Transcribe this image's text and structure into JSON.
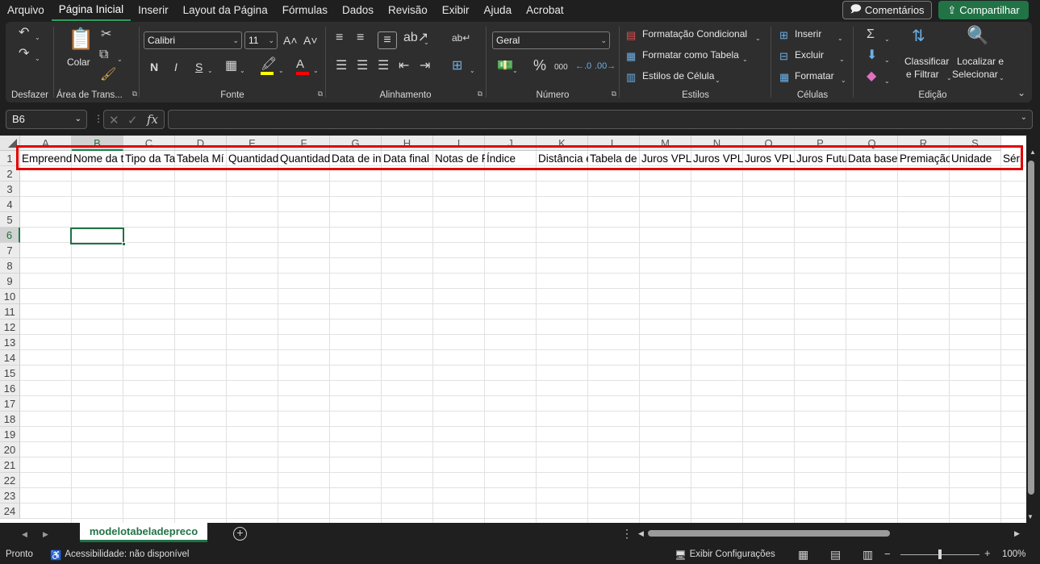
{
  "menu": {
    "items": [
      "Arquivo",
      "Página Inicial",
      "Inserir",
      "Layout da Página",
      "Fórmulas",
      "Dados",
      "Revisão",
      "Exibir",
      "Ajuda",
      "Acrobat"
    ],
    "active_index": 1,
    "comments_label": "Comentários",
    "share_label": "Compartilhar"
  },
  "ribbon": {
    "undo": {
      "group_label": "Desfazer"
    },
    "clipboard": {
      "paste_label": "Colar",
      "group_label": "Área de Trans..."
    },
    "font": {
      "font_name": "Calibri",
      "font_size": "11",
      "bold": "N",
      "italic": "I",
      "underline": "S",
      "group_label": "Fonte"
    },
    "alignment": {
      "group_label": "Alinhamento"
    },
    "number": {
      "format": "Geral",
      "currency": "$",
      "percent": "%",
      "thousands": "000",
      "group_label": "Número"
    },
    "styles": {
      "conditional": "Formatação Condicional",
      "as_table": "Formatar como Tabela",
      "cell_styles": "Estilos de Célula",
      "group_label": "Estilos"
    },
    "cells": {
      "insert": "Inserir",
      "delete": "Excluir",
      "format": "Formatar",
      "group_label": "Células"
    },
    "editing": {
      "sort_line1": "Classificar",
      "sort_line2": "e Filtrar",
      "find_line1": "Localizar e",
      "find_line2": "Selecionar",
      "group_label": "Edição"
    },
    "colors": {
      "highlight": "#ffff00",
      "font_color": "#ff0000"
    }
  },
  "formula_bar": {
    "name_box": "B6",
    "fx": "fx",
    "value": ""
  },
  "sheet": {
    "columns": [
      "A",
      "B",
      "C",
      "D",
      "E",
      "F",
      "G",
      "H",
      "I",
      "J",
      "K",
      "L",
      "M",
      "N",
      "O",
      "P",
      "Q",
      "R",
      "S"
    ],
    "selected_column": "B",
    "rows": [
      "1",
      "2",
      "3",
      "4",
      "5",
      "6",
      "7",
      "8",
      "9",
      "10",
      "11",
      "12",
      "13",
      "14",
      "15",
      "16",
      "17",
      "18",
      "19",
      "20",
      "21",
      "22",
      "23",
      "24"
    ],
    "selected_row": "6",
    "active_cell": "B6",
    "row1": [
      "Empreend",
      "Nome da t",
      "Tipo da Ta",
      "Tabela Mí",
      "Quantidad",
      "Quantidad",
      "Data de in",
      "Data final",
      "Notas de F",
      "Índice",
      "Distância e",
      "Tabela de",
      "Juros VPL",
      "Juros VPL",
      "Juros VPL",
      "Juros Futu",
      "Data base",
      "Premiação",
      "Unidade",
      "Séri"
    ]
  },
  "tabs": {
    "sheet_name": "modelotabeladepreco"
  },
  "status": {
    "ready": "Pronto",
    "accessibility": "Acessibilidade: não disponível",
    "display_settings": "Exibir Configurações",
    "zoom": "100%"
  },
  "accent_colors": {
    "excel_green": "#217346",
    "highlight_box": "#e00000"
  }
}
